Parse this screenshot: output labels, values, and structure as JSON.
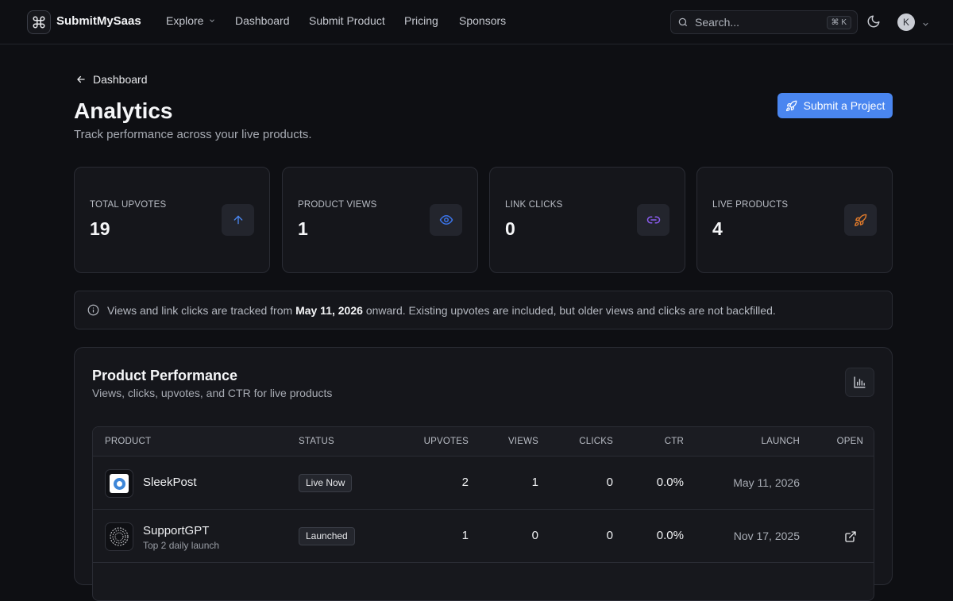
{
  "nav": {
    "brand": "SubmitMySaas",
    "links": [
      "Explore",
      "Dashboard",
      "Submit Product",
      "Pricing",
      "Sponsors"
    ],
    "search_placeholder": "Search...",
    "search_shortcut": "⌘ K",
    "avatar_initial": "K"
  },
  "header": {
    "back_label": "Dashboard",
    "title": "Analytics",
    "subtitle": "Track performance across your live products.",
    "submit_button": "Submit a Project"
  },
  "stats": [
    {
      "label": "TOTAL UPVOTES",
      "value": "19",
      "icon": "arrow-up-icon",
      "color": "#4a86f0"
    },
    {
      "label": "PRODUCT VIEWS",
      "value": "1",
      "icon": "eye-icon",
      "color": "#3b74e8"
    },
    {
      "label": "LINK CLICKS",
      "value": "0",
      "icon": "link-icon",
      "color": "#8a5cf0"
    },
    {
      "label": "LIVE PRODUCTS",
      "value": "4",
      "icon": "rocket-icon",
      "color": "#e07a2a"
    }
  ],
  "notice": {
    "before": "Views and link clicks are tracked from",
    "date": "May 11, 2026",
    "after": "onward. Existing upvotes are included, but older views and clicks are not backfilled."
  },
  "performance": {
    "title": "Product Performance",
    "subtitle": "Views, clicks, upvotes, and CTR for live products",
    "columns": [
      "PRODUCT",
      "STATUS",
      "UPVOTES",
      "VIEWS",
      "CLICKS",
      "CTR",
      "LAUNCH",
      "OPEN"
    ],
    "rows": [
      {
        "name": "SleekPost",
        "note": "",
        "status": "Live Now",
        "upvotes": "2",
        "views": "1",
        "clicks": "0",
        "ctr": "0.0%",
        "launch": "May 11, 2026",
        "open": false
      },
      {
        "name": "SupportGPT",
        "note": "Top 2 daily launch",
        "status": "Launched",
        "upvotes": "1",
        "views": "0",
        "clicks": "0",
        "ctr": "0.0%",
        "launch": "Nov 17, 2025",
        "open": true
      }
    ]
  }
}
